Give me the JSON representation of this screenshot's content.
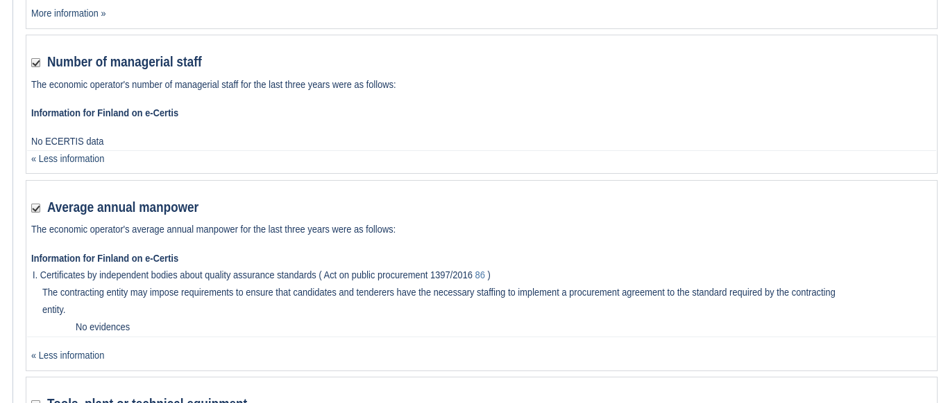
{
  "top_panel": {
    "more_info_link": "More information »"
  },
  "managerial_staff": {
    "title": "Number of managerial staff",
    "checked": true,
    "description": "The economic operator's number of managerial staff for the last three years were as follows:",
    "ecertis_heading": "Information for Finland on e-Certis",
    "ecertis_status": "No ECERTIS data",
    "less_info_link": "« Less information"
  },
  "annual_manpower": {
    "title": "Average annual manpower",
    "checked": true,
    "description": "The economic operator's average annual manpower for the last three years were as follows:",
    "ecertis_heading": "Information for Finland on e-Certis",
    "certificate_item": "I. Certificates by independent bodies about quality assurance standards ( Act on public procurement 1397/2016",
    "certificate_ref": "86",
    "certificate_close": ")",
    "requirement_line1": "The contracting entity may impose requirements to ensure that candidates and tenderers have the necessary staffing to implement a procurement agreement to the standard required by the contracting",
    "requirement_line2": "entity.",
    "evidence_status": "No evidences",
    "less_info_link": "« Less information"
  },
  "tools_equipment": {
    "title": "Tools, plant or technical equipment",
    "checked": false
  }
}
